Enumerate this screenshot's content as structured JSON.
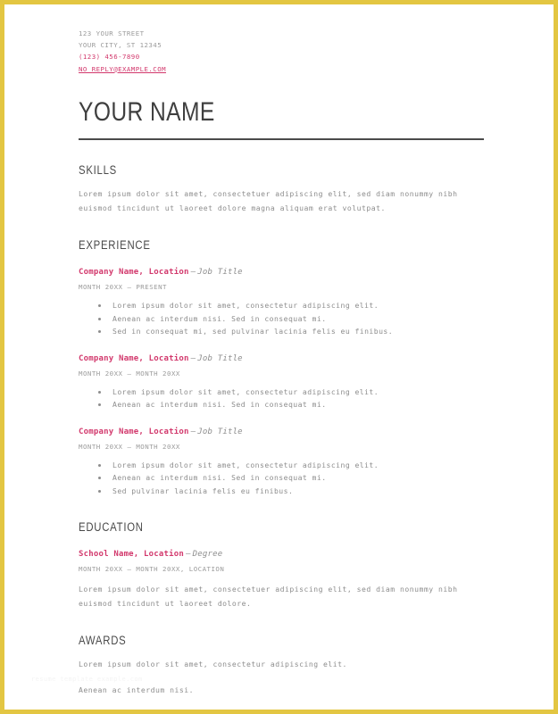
{
  "document": {
    "accent_color": "#d2386c",
    "border_color": "#e3c642",
    "heading_color": "#4a4a4a",
    "body_color": "#8d8d8d"
  },
  "contact": {
    "street": "123 YOUR STREET",
    "city_state_zip": "YOUR CITY, ST 12345",
    "phone": "(123) 456-7890",
    "email": "NO_REPLY@EXAMPLE.COM"
  },
  "name": "YOUR NAME",
  "sections": {
    "skills": {
      "title": "SKILLS",
      "body": "Lorem ipsum dolor sit amet, consectetuer adipiscing elit, sed diam nonummy nibh euismod tincidunt ut laoreet dolore magna aliquam erat volutpat."
    },
    "experience": {
      "title": "EXPERIENCE",
      "entries": [
        {
          "org": "Company Name, Location",
          "separator": "–",
          "role": "Job Title",
          "dates": "MONTH 20XX – PRESENT",
          "bullets": [
            "Lorem ipsum dolor sit amet, consectetur adipiscing elit.",
            "Aenean ac interdum nisi. Sed in consequat mi.",
            "Sed in consequat mi, sed pulvinar lacinia felis eu finibus."
          ]
        },
        {
          "org": "Company Name, Location",
          "separator": "–",
          "role": "Job Title",
          "dates": "MONTH 20XX – MONTH 20XX",
          "bullets": [
            "Lorem ipsum dolor sit amet, consectetur adipiscing elit.",
            "Aenean ac interdum nisi. Sed in consequat mi."
          ]
        },
        {
          "org": "Company Name, Location",
          "separator": "–",
          "role": "Job Title",
          "dates": "MONTH 20XX – MONTH 20XX",
          "bullets": [
            "Lorem ipsum dolor sit amet, consectetur adipiscing elit.",
            "Aenean ac interdum nisi. Sed in consequat mi.",
            "Sed pulvinar lacinia felis eu finibus."
          ]
        }
      ]
    },
    "education": {
      "title": "EDUCATION",
      "entry": {
        "org": "School Name, Location",
        "separator": "–",
        "role": "Degree",
        "dates": "MONTH 20XX – MONTH 20XX, LOCATION",
        "description": "Lorem ipsum dolor sit amet, consectetuer adipiscing elit, sed diam nonummy nibh euismod tincidunt ut laoreet dolore."
      }
    },
    "awards": {
      "title": "AWARDS",
      "lines": [
        "Lorem ipsum dolor sit amet, consectetur adipiscing elit.",
        "Aenean ac interdum nisi."
      ]
    }
  },
  "watermark": "resume template example.com"
}
